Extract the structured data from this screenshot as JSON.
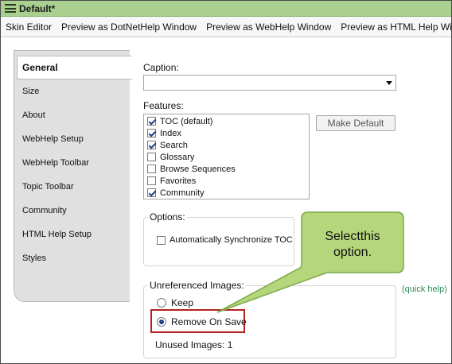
{
  "window": {
    "title": "Default*"
  },
  "toolbar": {
    "items": [
      "Skin Editor",
      "Preview as DotNetHelp Window",
      "Preview as WebHelp Window",
      "Preview as HTML Help Windo"
    ]
  },
  "sidebar": {
    "items": [
      {
        "label": "General",
        "active": true
      },
      {
        "label": "Size"
      },
      {
        "label": "About"
      },
      {
        "label": "WebHelp Setup"
      },
      {
        "label": "WebHelp Toolbar"
      },
      {
        "label": "Topic Toolbar"
      },
      {
        "label": "Community"
      },
      {
        "label": "HTML Help Setup"
      },
      {
        "label": "Styles"
      }
    ]
  },
  "main": {
    "caption_label": "Caption:",
    "caption_value": "",
    "features_label": "Features:",
    "features": [
      {
        "label": "TOC (default)",
        "checked": true
      },
      {
        "label": "Index",
        "checked": true
      },
      {
        "label": "Search",
        "checked": true
      },
      {
        "label": "Glossary",
        "checked": false
      },
      {
        "label": "Browse Sequences",
        "checked": false
      },
      {
        "label": "Favorites",
        "checked": false
      },
      {
        "label": "Community",
        "checked": true
      }
    ],
    "make_default_label": "Make Default",
    "options_label": "Options:",
    "auto_sync_label": "Automatically Synchronize TOC",
    "unreferenced_label": "Unreferenced Images:",
    "keep_label": "Keep",
    "remove_label": "Remove On Save",
    "unused_images_label": "Unused Images: 1",
    "quick_help_label": "(quick help)"
  },
  "callout": {
    "line1": "Selectthis",
    "line2": "option."
  },
  "colors": {
    "titlebar": "#a9d08e",
    "callout_fill": "#b5d67a",
    "callout_border": "#7aa84a",
    "highlight": "#b22222",
    "link": "#2e8b57"
  }
}
